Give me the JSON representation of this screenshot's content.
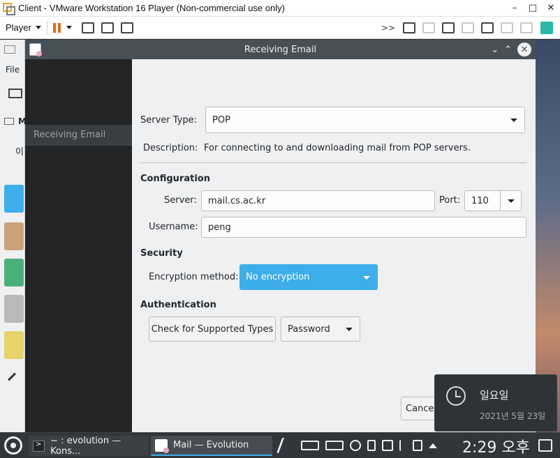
{
  "vmware": {
    "title": "Client - VMware Workstation 16 Player (Non-commercial use only)",
    "player_label": "Player",
    "winctl": {
      "minimize": "–",
      "maximize": "□",
      "close": "✕"
    },
    "toolbar_more": ">>"
  },
  "background_window": {
    "file_menu": "File",
    "partial_m": "M",
    "partial_korean": "이"
  },
  "dialog": {
    "title": "Receiving Email",
    "sidebar_items": [
      {
        "label": "Receiving Email"
      }
    ],
    "server_type_label": "Server Type:",
    "server_type_value": "POP",
    "description_label": "Description:",
    "description_text": "For connecting to and downloading mail from POP servers.",
    "configuration_heading": "Configuration",
    "server_label": "Server:",
    "server_value": "mail.cs.ac.kr",
    "port_label": "Port:",
    "port_value": "110",
    "username_label": "Username:",
    "username_value": "peng",
    "security_heading": "Security",
    "encryption_label": "Encryption method:",
    "encryption_value": "No encryption",
    "authentication_heading": "Authentication",
    "check_types_button": "Check for Supported Types",
    "auth_method_value": "Password",
    "cancel_button": "Cancel"
  },
  "notification": {
    "title": "일요일",
    "date": "2021년 5월 23일"
  },
  "taskbar": {
    "tasks": [
      {
        "label": "~ : evolution — Kons..."
      },
      {
        "label": "Mail — Evolution"
      }
    ],
    "clock": "2:29 오후"
  },
  "colors": {
    "accent": "#3daee9",
    "dialog_bg": "#eff0f1",
    "titlebar": "#475057",
    "sidebar": "#222426",
    "taskbar": "#31363b",
    "vm_pause": "#e8691a"
  }
}
